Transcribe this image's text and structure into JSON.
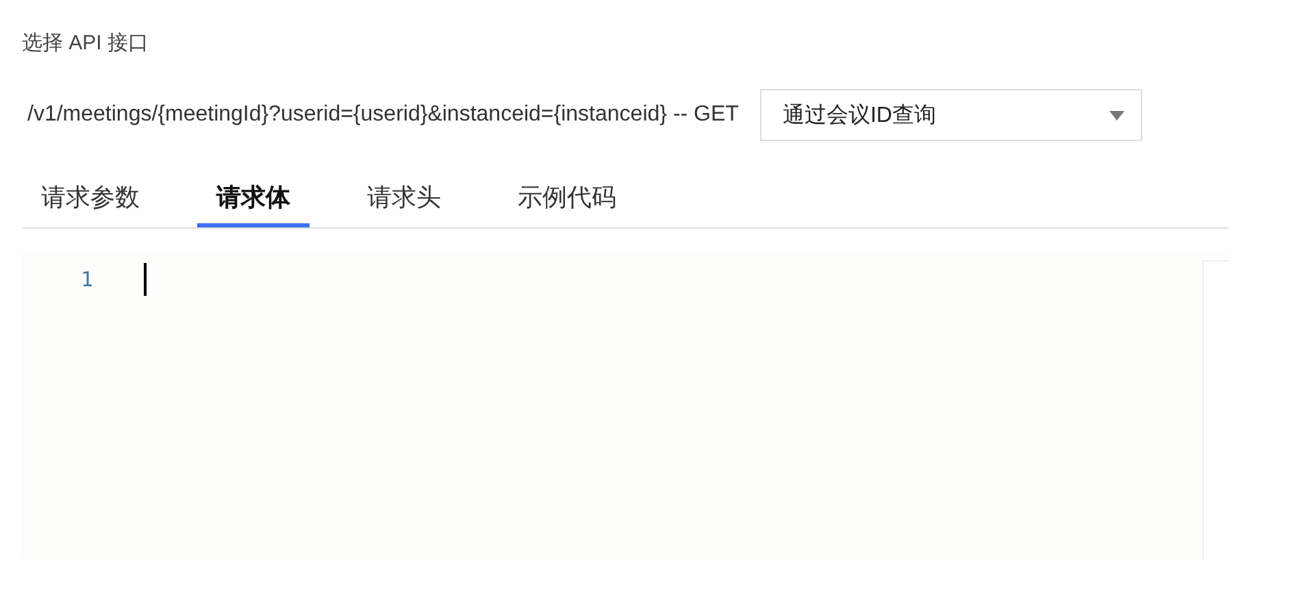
{
  "section_label": "选择 API 接口",
  "endpoint": {
    "path": "/v1/meetings/{meetingId}?userid={userid}&instanceid={instanceid} -- GET",
    "select": {
      "value": "通过会议ID查询"
    }
  },
  "tabs": [
    {
      "label": "请求参数",
      "selected": false
    },
    {
      "label": "请求体",
      "selected": true
    },
    {
      "label": "请求头",
      "selected": false
    },
    {
      "label": "示例代码",
      "selected": false
    }
  ],
  "editor": {
    "lines": [
      {
        "number": "1",
        "focused": true
      }
    ]
  }
}
